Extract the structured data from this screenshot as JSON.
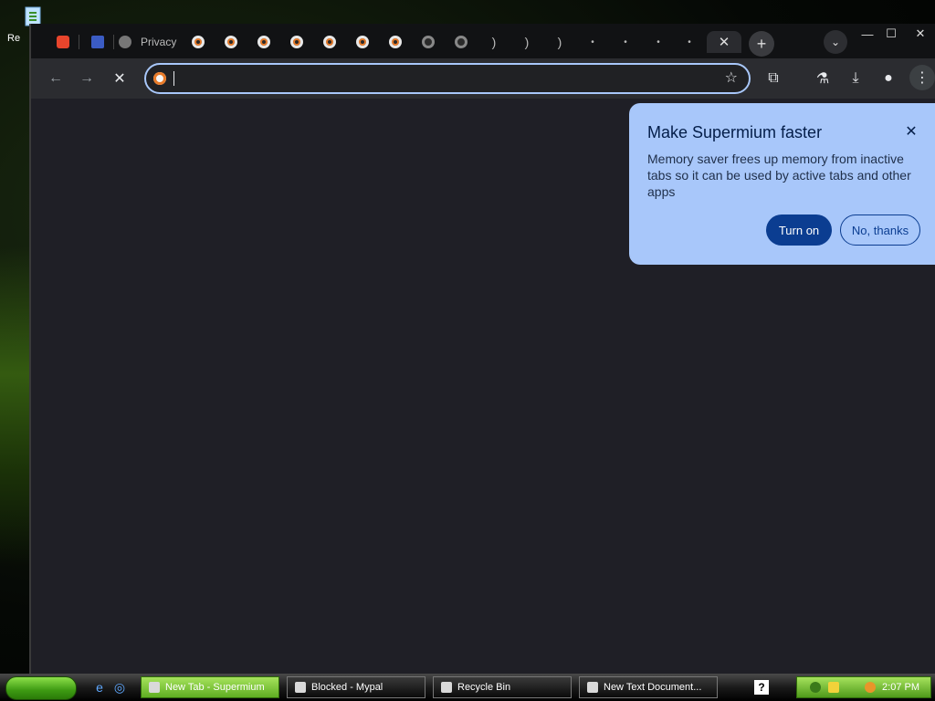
{
  "desktop": {
    "icons": [
      {
        "name": "recycle-bin-icon",
        "label": "Re"
      }
    ]
  },
  "browser": {
    "tabs": [
      {
        "icon": "brave-icon",
        "label": ""
      },
      {
        "icon": "app-icon",
        "label": ""
      },
      {
        "icon": "globe-icon",
        "label": "Privacy"
      },
      {
        "icon": "loading-icon",
        "label": ""
      },
      {
        "icon": "loading-icon",
        "label": ""
      },
      {
        "icon": "loading-icon",
        "label": ""
      },
      {
        "icon": "loading-icon",
        "label": ""
      },
      {
        "icon": "loading-icon",
        "label": ""
      },
      {
        "icon": "loading-icon",
        "label": ""
      },
      {
        "icon": "loading-icon",
        "label": ""
      },
      {
        "icon": "loading-icon",
        "label": ""
      },
      {
        "icon": "loading-icon",
        "label": ""
      },
      {
        "icon": "loading-icon",
        "label": ""
      },
      {
        "icon": "loading-icon",
        "label": ""
      },
      {
        "icon": "loading-icon",
        "label": ""
      },
      {
        "icon": "loading-icon",
        "label": ""
      },
      {
        "icon": "loading-icon",
        "label": ""
      }
    ],
    "active_tab_close": "✕",
    "new_tab": "+",
    "tab_search": "⌄",
    "window_controls": {
      "minimize": "—",
      "maximize": "☐",
      "close": "✕"
    },
    "toolbar": {
      "back": "←",
      "forward": "→",
      "stop": "✕",
      "omnibox_value": "",
      "bookmark": "☆",
      "extensions": "⧉",
      "labs": "⚗",
      "downloads": "⤓",
      "profile": "●",
      "menu": "⋮"
    }
  },
  "bubble": {
    "title": "Make Supermium faster",
    "close": "✕",
    "body": "Memory saver frees up memory from inactive tabs so it can be used by active tabs and other apps",
    "primary": "Turn on",
    "secondary": "No, thanks"
  },
  "taskbar": {
    "tasks": [
      {
        "label": "New Tab - Supermium",
        "active": true
      },
      {
        "label": "Blocked - Mypal",
        "active": false
      },
      {
        "label": "Recycle Bin",
        "active": false
      },
      {
        "label": "New Text Document...",
        "active": false
      }
    ],
    "help": "?",
    "clock": "2:07 PM"
  },
  "colors": {
    "accent": "#a8c7fa",
    "primary_button": "#0b3d91",
    "content_bg": "#1f1f26"
  }
}
